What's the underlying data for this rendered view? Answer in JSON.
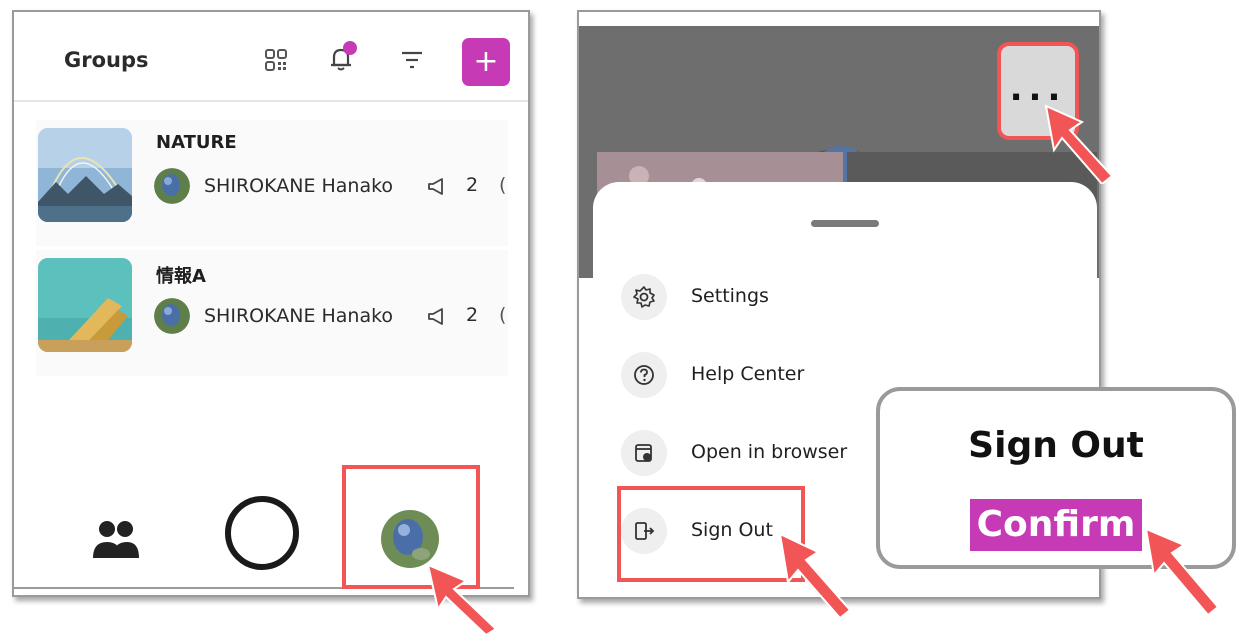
{
  "left_panel": {
    "header": {
      "title": "Groups",
      "icons": [
        "qr-code-icon",
        "bell-icon",
        "filter-icon"
      ],
      "add_label": "+",
      "notification_dot_color": "#c63ab6"
    },
    "groups": [
      {
        "name": "NATURE",
        "owner": "SHIROKANE Hanako",
        "announcements": "2",
        "clipped": "("
      },
      {
        "name": "情報A",
        "owner": "SHIROKANE Hanako",
        "announcements": "2",
        "clipped": "("
      }
    ],
    "bottom_nav": [
      "groups-icon",
      "home-circle-icon",
      "profile-avatar"
    ]
  },
  "right_panel": {
    "menu": [
      {
        "label": "Settings",
        "icon": "gear-icon"
      },
      {
        "label": "Help Center",
        "icon": "help-icon"
      },
      {
        "label": "Open in browser",
        "icon": "browser-icon"
      },
      {
        "label": "Sign Out",
        "icon": "sign-out-icon"
      }
    ],
    "more_label": "..."
  },
  "dialog": {
    "title": "Sign Out",
    "confirm_label": "Confirm"
  },
  "colors": {
    "accent": "#c63ab6",
    "highlight": "#f25555",
    "overlay": "#6e6e6e"
  }
}
